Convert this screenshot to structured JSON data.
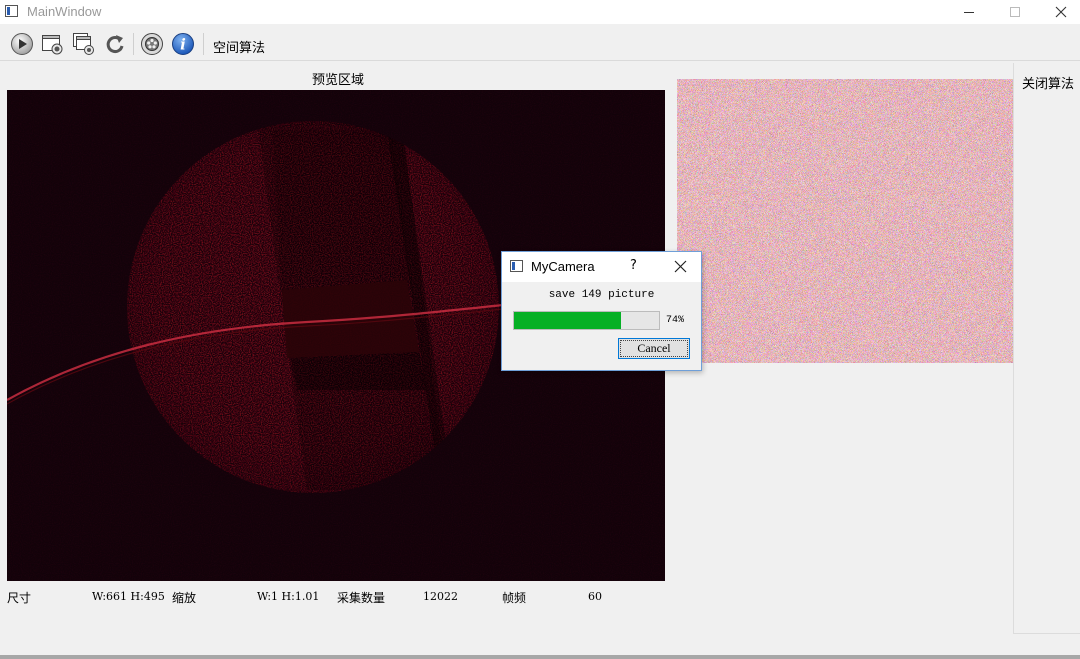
{
  "window": {
    "title": "MainWindow"
  },
  "toolbar": {
    "buttons": [
      "play-icon",
      "snapshot-icon",
      "multi-snapshot-icon",
      "refresh-icon",
      "settings-icon",
      "info-icon"
    ],
    "algorithm_label": "空间算法"
  },
  "preview": {
    "title": "预览区域"
  },
  "right_panel": {
    "close_algorithm_label": "关闭算法"
  },
  "status": {
    "size_label": "尺寸",
    "size_value": "W:661 H:495",
    "zoom_label": "缩放",
    "zoom_value": "W:1 H:1.01",
    "count_label": "采集数量",
    "count_value": "12022",
    "fps_label": "帧频",
    "fps_value": "60"
  },
  "dialog": {
    "title": "MyCamera",
    "help": "?",
    "message": "save 149 picture",
    "progress": 74,
    "progress_text": "74%",
    "cancel_label": "Cancel"
  },
  "colors": {
    "progress_fill": "#06b025",
    "focus_border": "#0078d7",
    "preview_red": "#b01224"
  }
}
